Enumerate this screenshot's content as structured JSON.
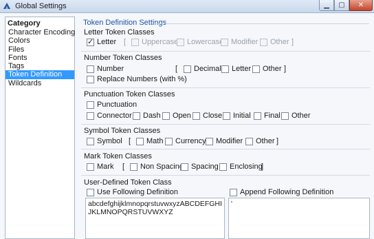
{
  "window": {
    "title": "Global Settings",
    "minimize_glyph": "▁",
    "maximize_glyph": "▢",
    "close_glyph": "✕"
  },
  "category": {
    "title": "Category",
    "items": [
      {
        "label": "Character Encoding",
        "selected": false
      },
      {
        "label": "Colors",
        "selected": false
      },
      {
        "label": "Files",
        "selected": false
      },
      {
        "label": "Fonts",
        "selected": false
      },
      {
        "label": "Tags",
        "selected": false
      },
      {
        "label": "Token Definition",
        "selected": true
      },
      {
        "label": "Wildcards",
        "selected": false
      }
    ]
  },
  "panel": {
    "title": "Token Definition Settings",
    "open_bracket": "[",
    "close_bracket": "]",
    "letter": {
      "title": "Letter Token Classes",
      "letter": {
        "label": "Letter",
        "checked": true
      },
      "uppercase": {
        "label": "Uppercase",
        "checked": false
      },
      "lowercase": {
        "label": "Lowercase",
        "checked": false
      },
      "modifier": {
        "label": "Modifier",
        "checked": false
      },
      "other": {
        "label": "Other",
        "checked": false
      }
    },
    "number": {
      "title": "Number Token Classes",
      "number": {
        "label": "Number",
        "checked": false
      },
      "decimal": {
        "label": "Decimal",
        "checked": false
      },
      "letter": {
        "label": "Letter",
        "checked": false
      },
      "other": {
        "label": "Other",
        "checked": false
      },
      "replace": {
        "label": "Replace Numbers (with %)",
        "checked": false
      }
    },
    "punctuation": {
      "title": "Punctuation Token Classes",
      "punctuation": {
        "label": "Punctuation",
        "checked": false
      },
      "connector": {
        "label": "Connector",
        "checked": false
      },
      "dash": {
        "label": "Dash",
        "checked": false
      },
      "open": {
        "label": "Open",
        "checked": false
      },
      "close": {
        "label": "Close",
        "checked": false
      },
      "initial": {
        "label": "Initial",
        "checked": false
      },
      "final": {
        "label": "Final",
        "checked": false
      },
      "other": {
        "label": "Other",
        "checked": false
      }
    },
    "symbol": {
      "title": "Symbol Token Classes",
      "symbol": {
        "label": "Symbol",
        "checked": false
      },
      "math": {
        "label": "Math",
        "checked": false
      },
      "currency": {
        "label": "Currency",
        "checked": false
      },
      "modifier": {
        "label": "Modifier",
        "checked": false
      },
      "other": {
        "label": "Other",
        "checked": false
      }
    },
    "mark": {
      "title": "Mark Token Classes",
      "mark": {
        "label": "Mark",
        "checked": false
      },
      "non_spacing": {
        "label": "Non Spacing",
        "checked": false
      },
      "spacing": {
        "label": "Spacing",
        "checked": false
      },
      "enclosing": {
        "label": "Enclosing",
        "checked": false
      }
    },
    "user_defined": {
      "title": "User-Defined Token Class",
      "use_following": {
        "label": "Use Following Definition",
        "checked": false
      },
      "append_following": {
        "label": "Append Following Definition",
        "checked": false
      },
      "definition_text": "abcdefghijklmnopqrstuvwxyzABCDEFGHIJKLMNOPQRSTUVWXYZ",
      "append_text": "'"
    }
  }
}
